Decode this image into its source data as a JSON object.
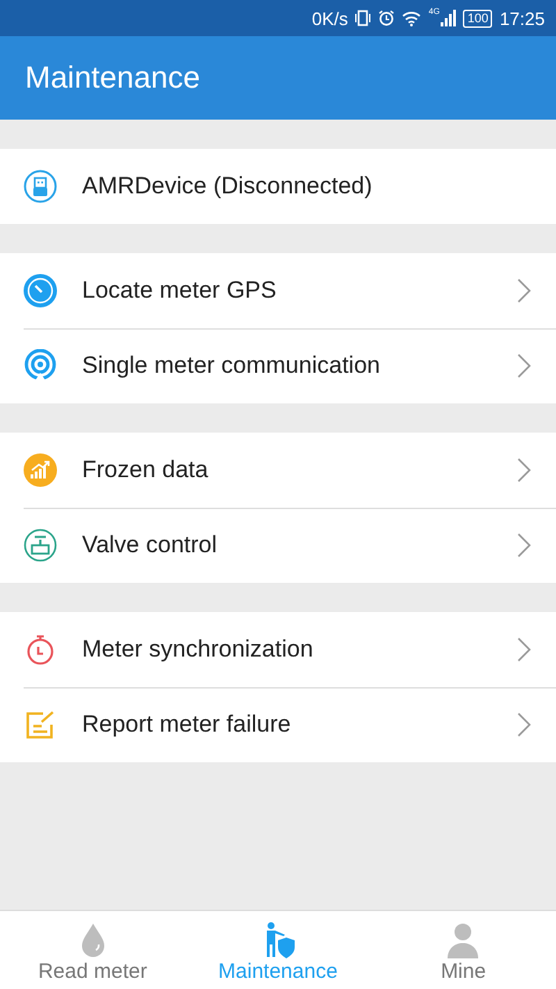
{
  "status_bar": {
    "speed": "0K/s",
    "network": "4G",
    "battery": "100",
    "time": "17:25"
  },
  "app_bar": {
    "title": "Maintenance"
  },
  "sections": [
    {
      "items": [
        {
          "kind": "usb",
          "label": "AMRDevice (Disconnected)",
          "chevron": false
        }
      ]
    },
    {
      "items": [
        {
          "kind": "gps",
          "label": "Locate meter GPS",
          "chevron": true
        },
        {
          "kind": "signal",
          "label": "Single meter communication",
          "chevron": true
        }
      ]
    },
    {
      "items": [
        {
          "kind": "chart",
          "label": "Frozen data",
          "chevron": true
        },
        {
          "kind": "valve",
          "label": "Valve control",
          "chevron": true
        }
      ]
    },
    {
      "items": [
        {
          "kind": "timer",
          "label": "Meter synchronization",
          "chevron": true
        },
        {
          "kind": "report",
          "label": "Report meter failure",
          "chevron": true
        }
      ]
    }
  ],
  "bottom_nav": [
    {
      "kind": "drop",
      "label": "Read meter",
      "selected": false
    },
    {
      "kind": "worker",
      "label": "Maintenance",
      "selected": true
    },
    {
      "kind": "person",
      "label": "Mine",
      "selected": false
    }
  ]
}
